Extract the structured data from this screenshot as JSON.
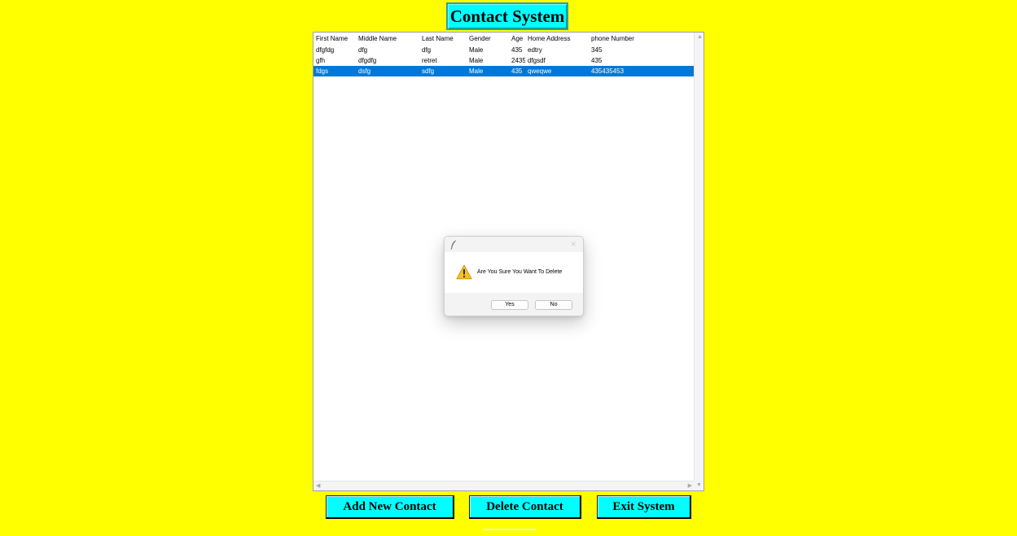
{
  "app": {
    "title": "Contact System"
  },
  "table": {
    "columns": [
      "First Name",
      "Middle Name",
      "Last Name",
      "Gender",
      "Age",
      "Home Address",
      "phone Number"
    ],
    "rows": [
      {
        "first": "dfgfdg",
        "middle": "dfg",
        "last": "dfg",
        "gender": "Male",
        "age": "435",
        "address": "edtry",
        "phone": "345"
      },
      {
        "first": "gfh",
        "middle": "dfgdfg",
        "last": "retret",
        "gender": "Male",
        "age": "2435",
        "address": "dfgsdf",
        "phone": "435"
      },
      {
        "first": "fdgs",
        "middle": "dsfg",
        "last": "sdfg",
        "gender": "Male",
        "age": "435",
        "address": "qweqwe",
        "phone": "435435453"
      }
    ],
    "selected_row_index": 2,
    "selection_color": "#0078d7"
  },
  "buttons": {
    "add": "Add New Contact",
    "delete": "Delete Contact",
    "exit": "Exit System"
  },
  "dialog": {
    "message": "Are You Sure You Want To Delete",
    "icon": "warning-icon",
    "yes": "Yes",
    "no": "No",
    "close_glyph": "✕"
  },
  "scrollbar": {
    "up": "▲",
    "down": "▼",
    "left": "◀",
    "right": "▶"
  },
  "colors": {
    "background": "#ffff00",
    "accent": "#00ffff"
  }
}
